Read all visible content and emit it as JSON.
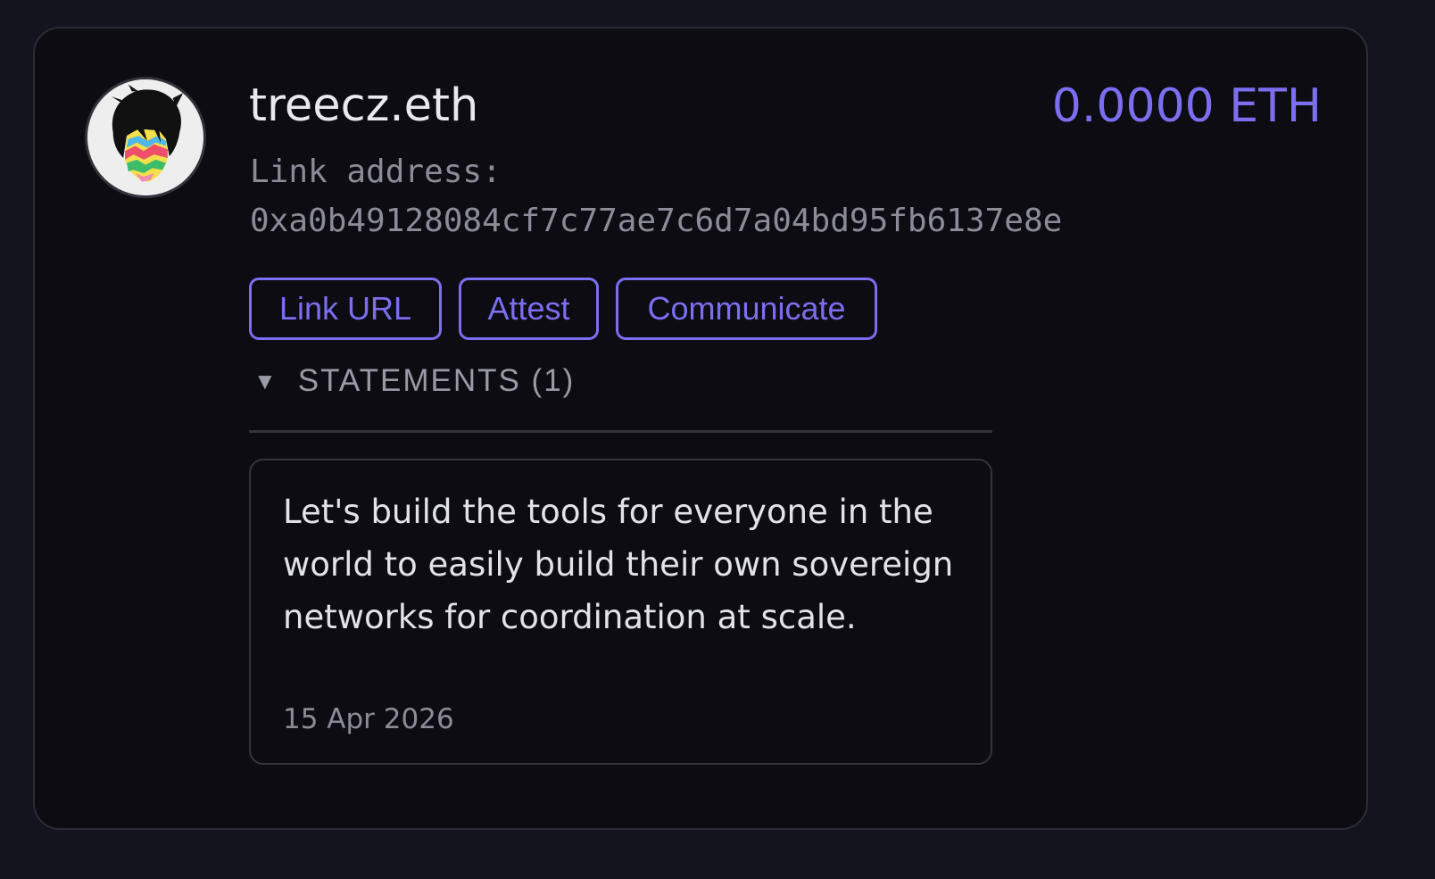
{
  "profile": {
    "name": "treecz.eth",
    "balance": "0.0000 ETH",
    "address_label": "Link address:",
    "address": "0xa0b49128084cf7c77ae7c6d7a04bd95fb6137e8e"
  },
  "actions": {
    "link_url": "Link URL",
    "attest": "Attest",
    "communicate": "Communicate"
  },
  "statements": {
    "toggle_icon": "▼",
    "header": "STATEMENTS (1)",
    "items": [
      {
        "text": "Let's build the tools for everyone in the world to easily build their own sovereign networks for coordination at scale.",
        "date": "15 Apr 2026"
      }
    ]
  },
  "colors": {
    "accent": "#7b6ef0",
    "background": "#14141f",
    "card": "#0c0c12"
  }
}
